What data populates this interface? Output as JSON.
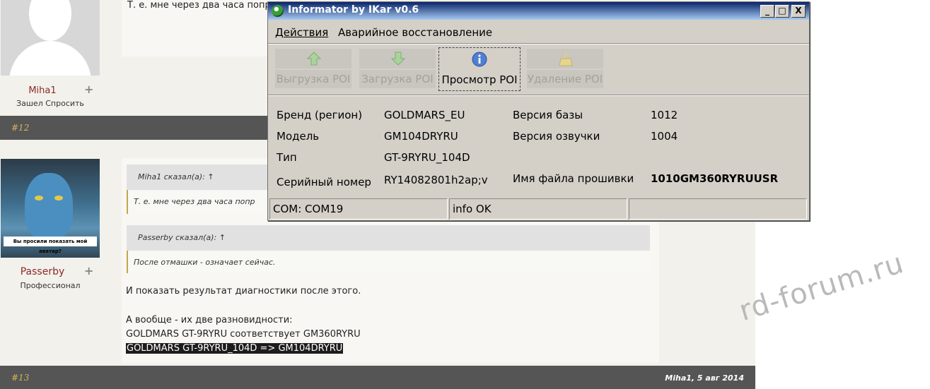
{
  "forum": {
    "post1": {
      "quote_text": "Т. е. мне через два часа попр",
      "username": "Miha1",
      "rank": "Зашел Спросить"
    },
    "post12": {
      "number": "#12"
    },
    "post2": {
      "username": "Passerby",
      "rank": "Профессионал",
      "avatar_caption": "Вы просили показать мой аватар?",
      "quote1_head": "Miha1 сказал(а): ↑",
      "quote1_body": "Т. е. мне через два часа попр",
      "quote2_head": "Passerby сказал(а): ↑",
      "quote2_body": "После отмашки - означает сейчас.",
      "lines": [
        "И показать результат диагностики после этого.",
        "А вообще - их две разновидности:",
        "GOLDMARS GT-9RYRU соответствует GM360RYRU",
        "GOLDMARS GT-9RYRU_104D => GM104DRYRU"
      ]
    },
    "post13": {
      "number": "#13",
      "meta": "Miha1, 5 авг 2014"
    },
    "watermark": "rd-forum.ru"
  },
  "window": {
    "title": "Informator by IKar v0.6",
    "title_buttons": [
      "_",
      "□",
      "X"
    ],
    "menu": [
      "Действия",
      "Аварийное восстановление"
    ],
    "toolbar": [
      {
        "label": "Выгрузка POI",
        "icon": "arrow-up-icon",
        "enabled": false
      },
      {
        "label": "Загрузка POI",
        "icon": "arrow-down-icon",
        "enabled": false
      },
      {
        "label": "Просмотр POI",
        "icon": "info-icon",
        "enabled": true
      },
      {
        "label": "Удаление POI",
        "icon": "broom-icon",
        "enabled": false
      }
    ],
    "fields": {
      "brand_label": "Бренд (регион)",
      "brand_value": "GOLDMARS_EU",
      "db_version_label": "Версия базы",
      "db_version_value": "1012",
      "model_label": "Модель",
      "model_value": "GM104DRYRU",
      "voice_version_label": "Версия озвучки",
      "voice_version_value": "1004",
      "type_label": "Тип",
      "type_value": "GT-9RYRU_104D",
      "serial_label": "Серийный номер",
      "serial_value": "RY14082801h2ap;v",
      "firmware_label": "Имя файла прошивки",
      "firmware_value": "1010GM360RYRUUSR"
    },
    "status": {
      "port": "COM: COM19",
      "info": "info OK",
      "extra": ""
    }
  },
  "colors": {
    "titlebar_start": "#0a246a",
    "titlebar_end": "#a6caf0",
    "window_face": "#d4d0c8",
    "forum_bar": "#555555",
    "post_number": "#d5b35a",
    "username": "#8b2a2a"
  }
}
